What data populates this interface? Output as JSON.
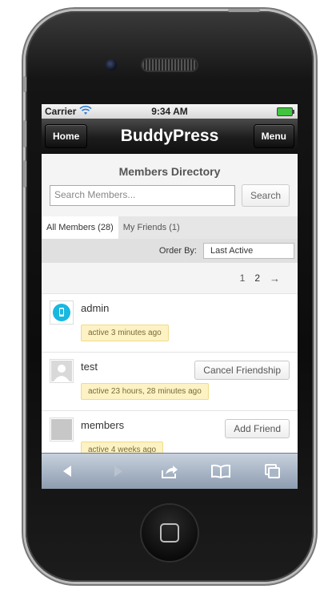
{
  "status_bar": {
    "carrier": "Carrier",
    "time": "9:34 AM"
  },
  "nav": {
    "title": "BuddyPress",
    "home_label": "Home",
    "menu_label": "Menu"
  },
  "directory": {
    "title": "Members Directory",
    "search_placeholder": "Search Members...",
    "search_button": "Search",
    "tabs": [
      {
        "label": "All Members (28)",
        "active": true
      },
      {
        "label": "My Friends (1)",
        "active": false
      }
    ],
    "order_label": "Order By:",
    "order_value": "Last Active",
    "pager": {
      "pages": [
        "1",
        "2"
      ],
      "current": "2",
      "next": "→"
    }
  },
  "members": [
    {
      "name": "admin",
      "activity": "active 3 minutes ago",
      "action": "",
      "avatar": "phone-avatar-icon"
    },
    {
      "name": "test",
      "activity": "active 23 hours, 28 minutes ago",
      "action": "Cancel Friendship",
      "avatar": "user-silhouette-icon"
    },
    {
      "name": "members",
      "activity": "active 4 weeks ago",
      "action": "Add Friend",
      "avatar": "blank-avatar-icon"
    }
  ],
  "colors": {
    "activity_bg": "#fdf2c4",
    "toolbar": "#a9b6c6",
    "navbar": "#1c1c1c"
  },
  "toolbar_icons": [
    "back-icon",
    "forward-icon",
    "share-icon",
    "bookmarks-icon",
    "tabs-icon"
  ]
}
